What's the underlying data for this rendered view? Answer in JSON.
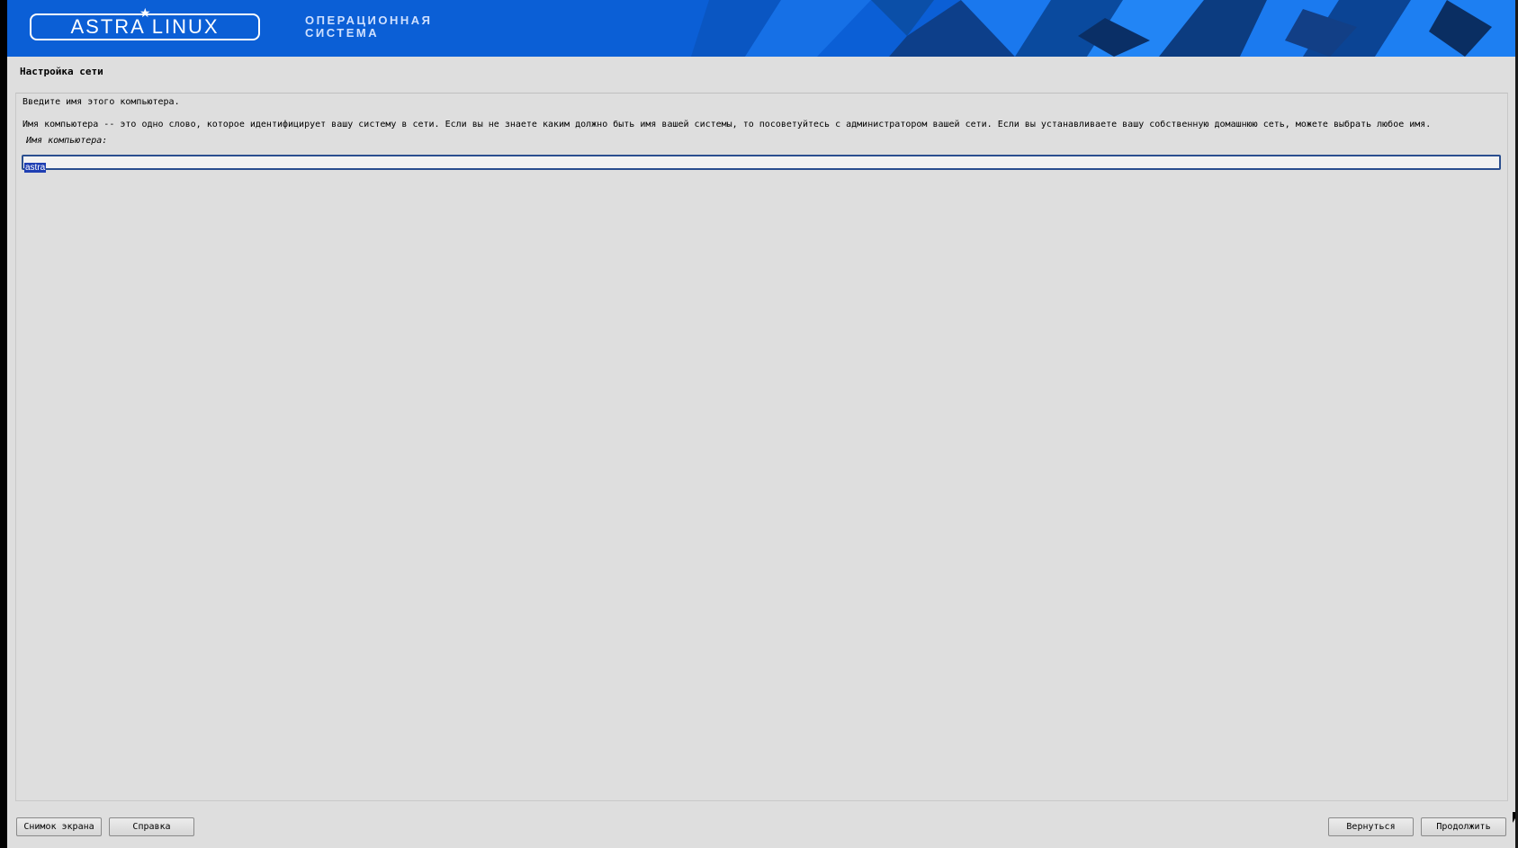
{
  "banner": {
    "logo_text": "ASTRA LINUX",
    "logo_mark": "®",
    "tagline_line1": "ОПЕРАЦИОННАЯ",
    "tagline_line2": "СИСТЕМА",
    "background_color": "#0b5fd6"
  },
  "page": {
    "title": "Настройка сети",
    "prompt": "Введите имя этого компьютера.",
    "description": "Имя компьютера -- это одно слово, которое идентифицирует вашу систему в сети. Если вы не знаете каким должно быть имя вашей системы, то посоветуйтесь с администратором вашей сети. Если вы устанавливаете вашу собственную домашнюю сеть, можете выбрать любое имя.",
    "field_label": "Имя компьютера:",
    "hostname_value": "astra"
  },
  "buttons": {
    "screenshot": "Снимок экрана",
    "help": "Справка",
    "back": "Вернуться",
    "continue": "Продолжить"
  },
  "icons": {
    "logo_star": "star-icon",
    "pointer": "mouse-pointer-icon"
  }
}
